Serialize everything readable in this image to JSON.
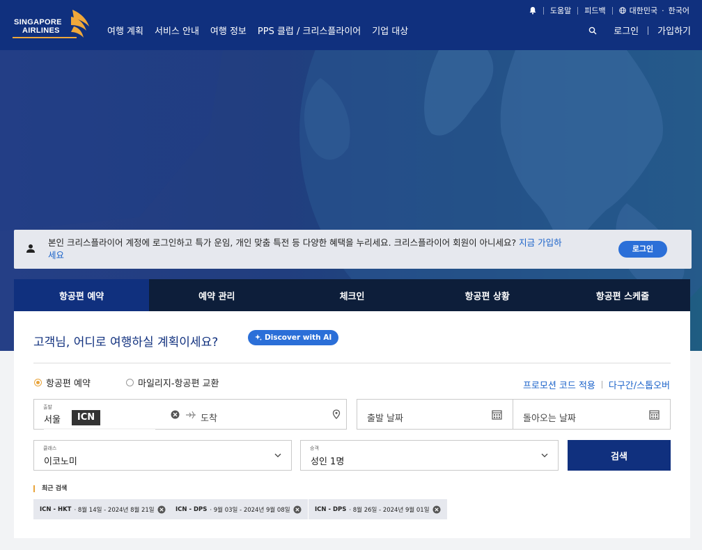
{
  "header": {
    "logo_line1": "SINGAPORE",
    "logo_line2": "AIRLINES",
    "nav": [
      "여행 계획",
      "서비스 안내",
      "여행 정보",
      "PPS 클럽 / 크리스플라이어",
      "기업 대상"
    ],
    "util": {
      "help": "도움말",
      "feedback": "피드백",
      "region": "대한민국",
      "language": "한국어"
    },
    "login": "로그인",
    "signup": "가입하기"
  },
  "banner": {
    "message": "본인 크리스플라이어 계정에 로그인하고 특가 운임, 개인 맞춤 특전 등 다양한 혜택을 누리세요. 크리스플라이어 회원이 아니세요? ",
    "link_part1": "지금 가입하",
    "link_part2": "세요",
    "login_button": "로그인"
  },
  "tabs": [
    "항공편 예약",
    "예약 관리",
    "체크인",
    "항공편 상황",
    "항공편 스케줄"
  ],
  "booking": {
    "question": "고객님, 어디로 여행하실 계획이세요?",
    "ai_button": "Discover with AI",
    "radio_book": "항공편 예약",
    "radio_miles": "마일리지-항공편 교환",
    "promo_link": "프로모션 코드 적용",
    "multi_link": "다구간/스톱오버",
    "from_label": "출발",
    "from_city": "서울",
    "from_code": "ICN",
    "to_placeholder": "도착",
    "depart_placeholder": "출발 날짜",
    "return_placeholder": "돌아오는 날짜",
    "class_label": "클래스",
    "class_value": "이코노미",
    "pax_label": "승객",
    "pax_value": "성인 1명",
    "search_button": "검색",
    "recent_title": "최근 검색",
    "recent": [
      {
        "route": "ICN - HKT",
        "dates": "· 8월 14일 - 2024년 8월 21일"
      },
      {
        "route": "ICN - DPS",
        "dates": "· 9월 03일 - 2024년 9월 08일"
      },
      {
        "route": "ICN - DPS",
        "dates": "· 8월 26일 - 2024년 9월 01일"
      }
    ]
  },
  "colors": {
    "brand_navy": "#10307e",
    "accent_gold": "#e8a33a",
    "link_blue": "#1a62c9",
    "tab_dark": "#0d1e3a"
  }
}
